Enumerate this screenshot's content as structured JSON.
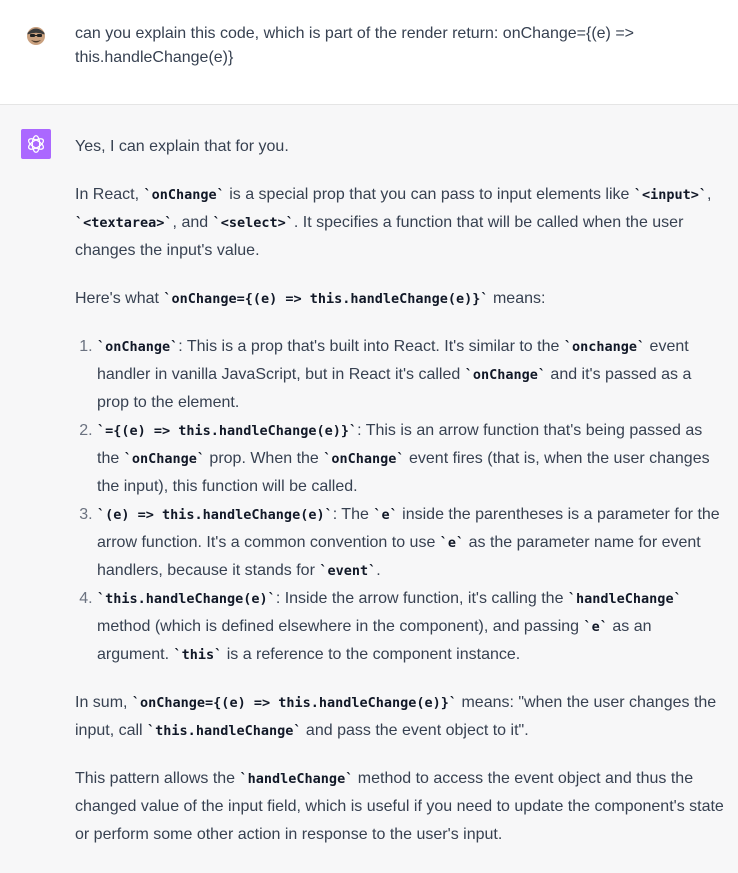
{
  "user": {
    "avatar_icon": "user-avatar-icon",
    "message": "can you explain this code, which is part of the render return: onChange={(e) => this.handleChange(e)}"
  },
  "assistant": {
    "avatar_icon": "openai-logo-icon",
    "accent_color": "#ab68ff",
    "intro": "Yes, I can explain that for you.",
    "para1": {
      "t1": "In React, ",
      "c1": "`onChange`",
      "t2": " is a special prop that you can pass to input elements like ",
      "c2": "`<input>`",
      "t3": ", ",
      "c3": "`<textarea>`",
      "t4": ", and ",
      "c4": "`<select>`",
      "t5": ". It specifies a function that will be called when the user changes the input's value."
    },
    "para2": {
      "t1": "Here's what ",
      "c1": "`onChange={(e) => this.handleChange(e)}`",
      "t2": " means:"
    },
    "list": [
      {
        "c1": "`onChange`",
        "t1": ": This is a prop that's built into React. It's similar to the ",
        "c2": "`onchange`",
        "t2": " event handler in vanilla JavaScript, but in React it's called ",
        "c3": "`onChange`",
        "t3": " and it's passed as a prop to the element."
      },
      {
        "c1": "`={(e) => this.handleChange(e)}`",
        "t1": ": This is an arrow function that's being passed as the ",
        "c2": "`onChange`",
        "t2": " prop. When the ",
        "c3": "`onChange`",
        "t3": " event fires (that is, when the user changes the input), this function will be called."
      },
      {
        "c1": "`(e) => this.handleChange(e)`",
        "t1": ": The ",
        "c2": "`e`",
        "t2": " inside the parentheses is a parameter for the arrow function. It's a common convention to use ",
        "c3": "`e`",
        "t3": " as the parameter name for event handlers, because it stands for ",
        "c4": "`event`",
        "t4": "."
      },
      {
        "c1": "`this.handleChange(e)`",
        "t1": ": Inside the arrow function, it's calling the ",
        "c2": "`handleChange`",
        "t2": " method (which is defined elsewhere in the component), and passing ",
        "c3": "`e`",
        "t3": " as an argument. ",
        "c4": "`this`",
        "t4": " is a reference to the component instance."
      }
    ],
    "para3": {
      "t1": "In sum, ",
      "c1": "`onChange={(e) => this.handleChange(e)}`",
      "t2": " means: \"when the user changes the input, call ",
      "c2": "`this.handleChange`",
      "t3": " and pass the event object to it\"."
    },
    "para4": {
      "t1": "This pattern allows the ",
      "c1": "`handleChange`",
      "t2": " method to access the event object and thus the changed value of the input field, which is useful if you need to update the component's state or perform some other action in response to the user's input."
    }
  }
}
